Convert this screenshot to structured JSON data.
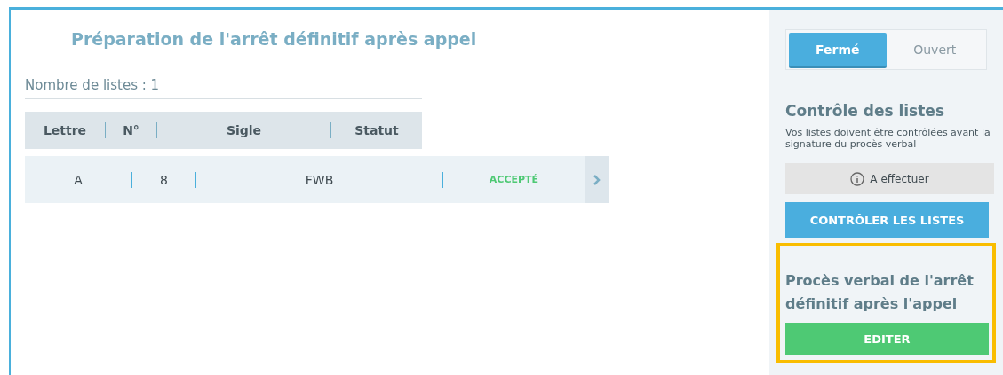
{
  "title": "Préparation de l'arrêt définitif après appel",
  "count_label": "Nombre de listes : 1",
  "table": {
    "columns": [
      "Lettre",
      "N°",
      "Sigle",
      "Statut"
    ],
    "rows": [
      {
        "cells": [
          "A",
          "8",
          "FWB",
          "ACCEPTÉ"
        ]
      }
    ]
  },
  "sidebar": {
    "toggle": [
      {
        "label": "Fermé",
        "selected": true
      },
      {
        "label": "Ouvert",
        "selected": false
      }
    ],
    "control": {
      "heading": "Contrôle des listes",
      "description": "Vos listes doivent être contrôlées avant la signature du procès verbal",
      "status": "A effectuer",
      "button": "CONTRÔLER LES LISTES"
    },
    "report": {
      "heading": "Procès verbal de l'arrêt définitif après l'appel",
      "button": "EDITER",
      "highlighted": true
    }
  }
}
